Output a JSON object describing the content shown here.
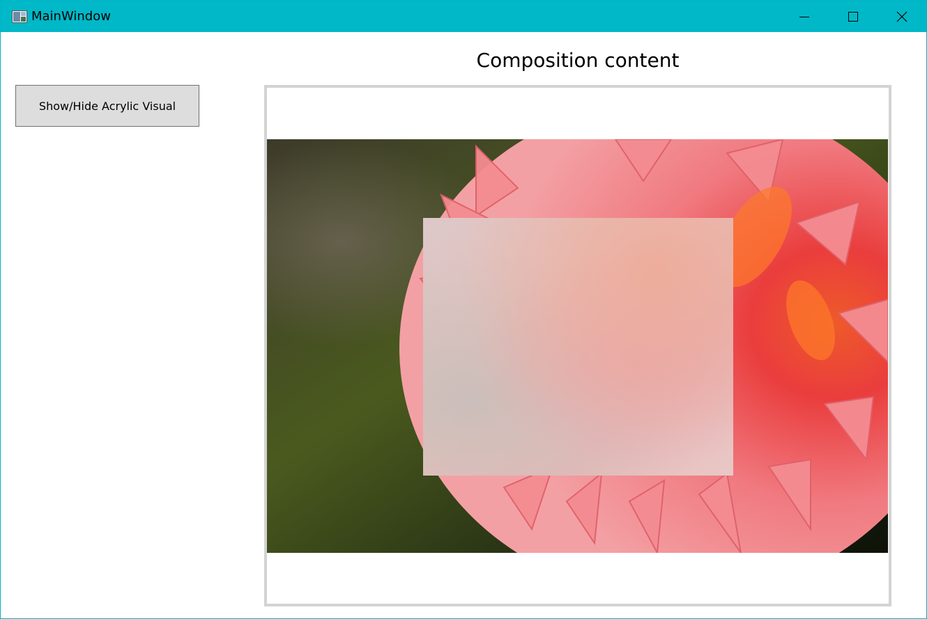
{
  "window": {
    "title": "MainWindow",
    "accent_color": "#00b8c7",
    "controls": {
      "minimize_icon": "minimize-icon",
      "maximize_icon": "maximize-icon",
      "close_icon": "close-icon"
    }
  },
  "sidebar": {
    "toggle_button_label": "Show/Hide Acrylic Visual"
  },
  "main": {
    "heading": "Composition content",
    "frame_border_color": "#d3d3d3",
    "image_subject": "red-pink dahlia flower photo",
    "overlay": "acrylic-visual"
  }
}
